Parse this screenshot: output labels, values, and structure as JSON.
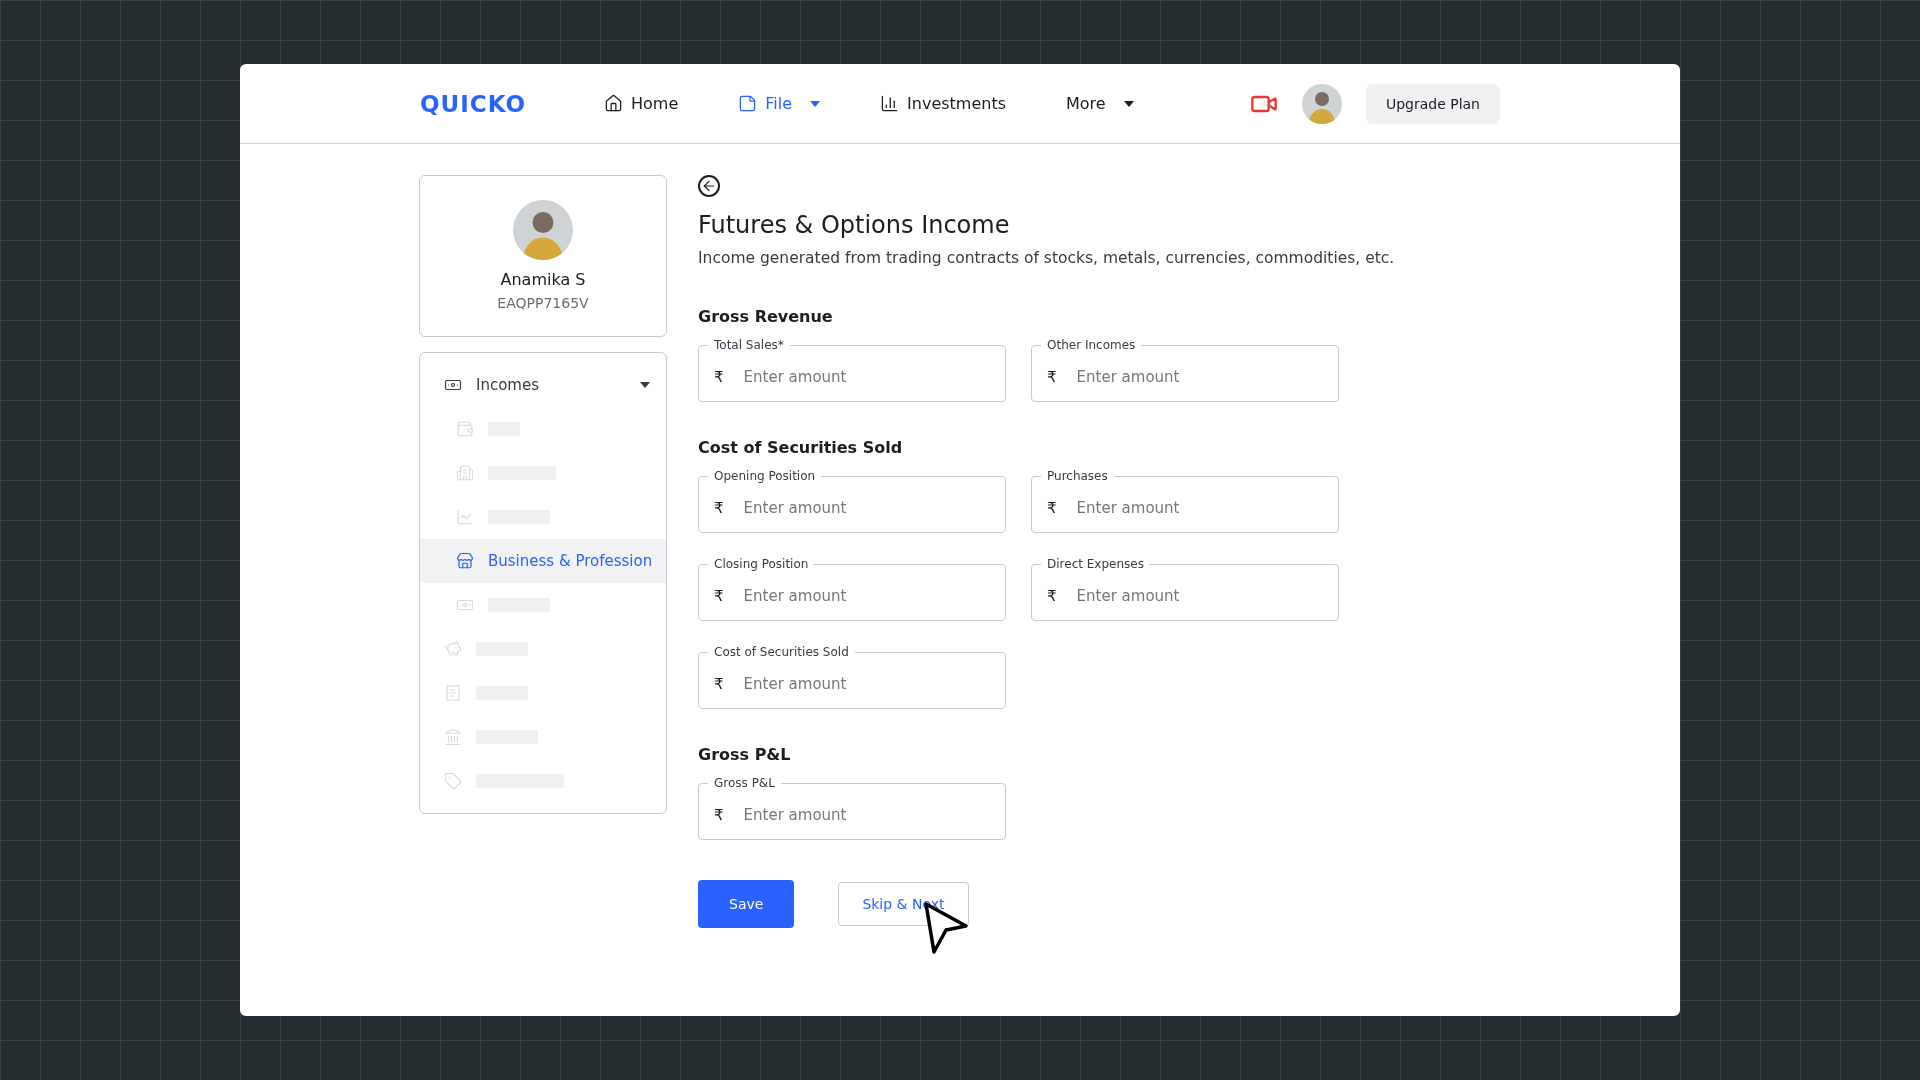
{
  "header": {
    "logo": "QUICKO",
    "nav": [
      {
        "label": "Home",
        "selected": false,
        "dropdown": false
      },
      {
        "label": "File",
        "selected": true,
        "dropdown": true
      },
      {
        "label": "Investments",
        "selected": false,
        "dropdown": false
      },
      {
        "label": "More",
        "selected": false,
        "dropdown": true
      }
    ],
    "upgrade_button": "Upgrade Plan"
  },
  "sidebar": {
    "profile": {
      "name": "Anamika S",
      "pan": "EAQPP7165V"
    },
    "items": [
      {
        "kind": "group",
        "label": "Incomes",
        "expanded": true,
        "children": [
          {
            "kind": "placeholder",
            "selected": false
          },
          {
            "kind": "placeholder",
            "selected": false
          },
          {
            "kind": "placeholder",
            "selected": false
          },
          {
            "kind": "item",
            "label": "Business & Profession",
            "selected": true
          },
          {
            "kind": "placeholder",
            "selected": false
          }
        ]
      },
      {
        "kind": "placeholder",
        "selected": false
      },
      {
        "kind": "placeholder",
        "selected": false
      },
      {
        "kind": "placeholder",
        "selected": false
      },
      {
        "kind": "placeholder",
        "selected": false
      }
    ]
  },
  "main": {
    "title": "Futures & Options Income",
    "subtitle": "Income generated from trading contracts of stocks, metals, currencies, commodities, etc.",
    "sections": [
      {
        "heading": "Gross Revenue",
        "fields": [
          {
            "label": "Total Sales*",
            "currency": "₹",
            "placeholder": "Enter amount"
          },
          {
            "label": "Other Incomes",
            "currency": "₹",
            "placeholder": "Enter amount"
          }
        ]
      },
      {
        "heading": "Cost of Securities Sold",
        "fields": [
          {
            "label": "Opening Position",
            "currency": "₹",
            "placeholder": "Enter amount"
          },
          {
            "label": "Purchases",
            "currency": "₹",
            "placeholder": "Enter amount"
          },
          {
            "label": "Closing Position",
            "currency": "₹",
            "placeholder": "Enter amount"
          },
          {
            "label": "Direct Expenses",
            "currency": "₹",
            "placeholder": "Enter amount"
          },
          {
            "label": "Cost of Securities Sold",
            "currency": "₹",
            "placeholder": "Enter amount"
          }
        ]
      },
      {
        "heading": "Gross P&L",
        "fields": [
          {
            "label": "Gross P&L",
            "currency": "₹",
            "placeholder": "Enter amount"
          }
        ]
      }
    ],
    "buttons": [
      {
        "label": "Save",
        "kind": "primary"
      },
      {
        "label": "Skip & Next",
        "kind": "secondary"
      }
    ]
  }
}
